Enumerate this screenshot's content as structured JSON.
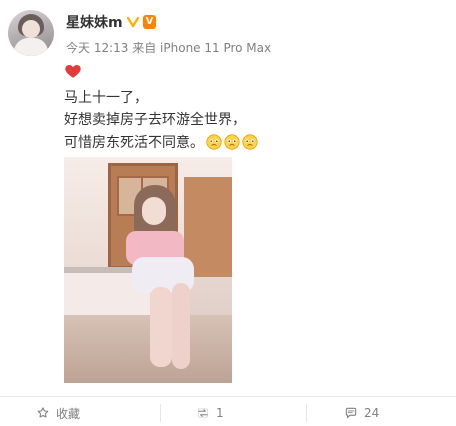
{
  "post": {
    "author": {
      "name": "星妹妹m",
      "badges": {
        "vip_icon": "v-icon",
        "level_icon": "level-badge-icon",
        "level_label": "V"
      },
      "avatar": "avatar-image"
    },
    "meta": {
      "time": "今天 12:13",
      "source": "来自 iPhone 11 Pro Max"
    },
    "content": {
      "emoji_heart": "heart-icon",
      "lines": [
        "马上十一了，",
        "好想卖掉房子去环游全世界，",
        "可惜房东死活不同意。"
      ],
      "trailing_emojis": [
        "pleading-face-icon",
        "pleading-face-icon",
        "pleading-face-icon"
      ]
    },
    "image": {
      "alt": "",
      "scene": "photo"
    }
  },
  "actions": {
    "favorite": {
      "icon": "star-icon",
      "label": "收藏"
    },
    "repost": {
      "icon": "repost-icon",
      "label": "1"
    },
    "comment": {
      "icon": "comment-icon",
      "label": "24"
    }
  },
  "colors": {
    "text_primary": "#333333",
    "text_secondary": "#808080",
    "badge_orange": "#ff8200",
    "divider": "#e6e6e6"
  }
}
